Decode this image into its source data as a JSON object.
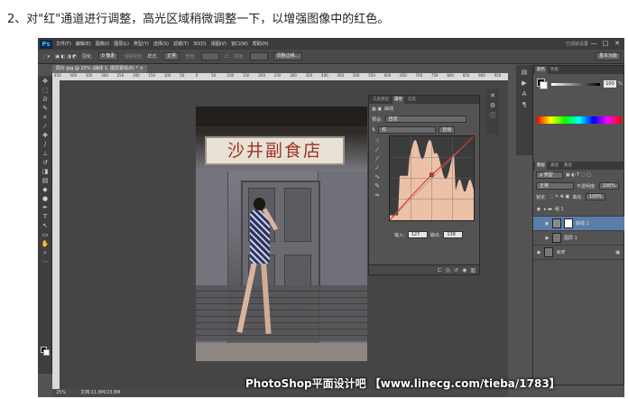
{
  "caption": "2、对\"红\"通道进行调整，高光区域稍微调整一下，以增强图像中的红色。",
  "app": {
    "logo": "Ps",
    "menus": [
      "文件(F)",
      "编辑(E)",
      "图像(I)",
      "图层(L)",
      "类型(Y)",
      "选择(S)",
      "滤镜(T)",
      "3D(D)",
      "视图(V)",
      "窗口(W)",
      "帮助(H)"
    ],
    "workspace_hint": "已成就设置",
    "window_controls": [
      "—",
      "□",
      "✕"
    ]
  },
  "options": {
    "feather_label": "羽化:",
    "feather_value": "0 像素",
    "antialias": "消除锯齿",
    "style_label": "样式:",
    "style_value": "正常",
    "width_label": "宽度:",
    "height_label": "高度:",
    "refine_edge": "调整边缘...",
    "workspace": "基本功能"
  },
  "document": {
    "tab": "原片.jpg @ 25% (曲线 1, 图层蒙版/8) * ×",
    "ruler_ticks": [
      "450",
      "400",
      "350",
      "300",
      "250",
      "200",
      "150",
      "100",
      "50",
      "0",
      "50",
      "100",
      "150",
      "200",
      "250",
      "300",
      "350",
      "400",
      "450",
      "500",
      "550",
      "600",
      "650",
      "700",
      "750",
      "800",
      "850",
      "900",
      "950"
    ]
  },
  "photo": {
    "sign_text": "沙井副食店"
  },
  "properties_panel": {
    "tabs": [
      "工具预设",
      "属性",
      "信息"
    ],
    "type_label": "曲线",
    "preset_label": "预设:",
    "preset_value": "自定",
    "channel_value": "红",
    "auto_button": "自动",
    "input_label": "输入:",
    "input_value": "127",
    "output_label": "输出:",
    "output_value": "138"
  },
  "curve": {
    "channel": "红",
    "points": [
      [
        0,
        0
      ],
      [
        127,
        138
      ],
      [
        255,
        255
      ]
    ],
    "histogram_color": "#f5c8ae",
    "curve_color": "#e0322a"
  },
  "right_panel": {
    "tabs": [
      "颜色",
      "色板"
    ],
    "k_value": "100",
    "percent": "%",
    "layers_tabs": [
      "图层",
      "通道",
      "路径"
    ],
    "kind_label": "ρ 类型",
    "blend_mode": "正常",
    "opacity_label": "不透明度:",
    "opacity_value": "100%",
    "lock_label": "锁定:",
    "fill_label": "填充:",
    "fill_value": "100%",
    "layers": [
      {
        "name": "组 1",
        "type": "group"
      },
      {
        "name": "曲线 1",
        "type": "adjustment",
        "selected": true
      },
      {
        "name": "图层 1",
        "type": "pixel"
      },
      {
        "name": "背景",
        "type": "background"
      }
    ]
  },
  "status": {
    "zoom": "25%",
    "doc_size": "文档:11.8M/23.8M"
  },
  "watermark": "PhotoShop平面设计吧 【www.linecg.com/tieba/1783】"
}
